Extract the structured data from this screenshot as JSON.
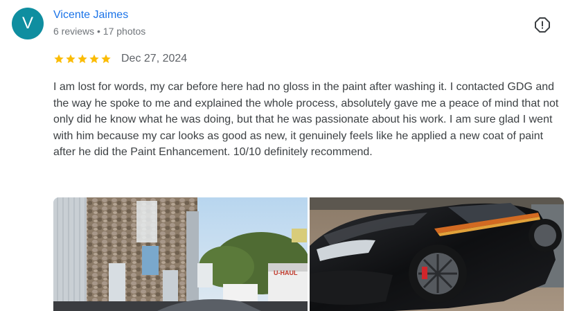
{
  "reviewer": {
    "initial": "V",
    "name": "Vicente Jaimes",
    "meta": "6 reviews • 17 photos",
    "avatar_color": "#0f8ea0"
  },
  "review": {
    "rating": 5,
    "max_rating": 5,
    "date": "Dec 27, 2024",
    "text": "I am lost for words, my car before here had no gloss in the paint after washing it. I contacted GDG and the way he spoke to me and explained the whole process, absolutely gave me a peace of mind that not only did he know what he was doing, but that he was passionate about his work. I am sure glad I went with him because my car looks as good as new, it genuinely feels like he applied a new coat of paint after he did the Paint Enhancement. 10/10 definitely recommend."
  },
  "icons": {
    "report": "report-flag-icon",
    "star": "star-icon"
  },
  "photos": [
    {
      "label": "U-HAUL"
    }
  ],
  "colors": {
    "name_link": "#1a73e8",
    "star": "#fbbc04",
    "meta_text": "#70757a"
  }
}
